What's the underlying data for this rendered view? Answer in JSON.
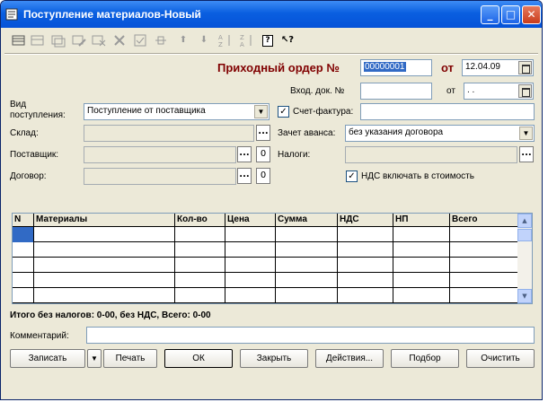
{
  "window": {
    "title": "Поступление материалов-Новый",
    "minimize_glyph": "_",
    "maximize_glyph": "□",
    "close_glyph": "✕"
  },
  "toolbar": {
    "icons": [
      "new-row-icon",
      "add-row-icon",
      "copy-row-icon",
      "edit-row-icon",
      "delete-row-icon",
      "mark-delete-icon",
      "fill-icon",
      "end-edit-icon",
      "move-up-icon",
      "move-down-icon",
      "sort-asc-icon",
      "sort-desc-icon",
      "help-icon",
      "context-help-icon"
    ],
    "up_glyph": "⬆",
    "down_glyph": "⬇",
    "help_glyph": "?",
    "context_help_glyph": "↖?"
  },
  "header": {
    "order_label": "Приходный ордер №",
    "order_number": "00000001",
    "date_label": "от",
    "date_value": "12.04.09",
    "in_doc_label": "Вход. док. №",
    "in_doc_value": "",
    "in_doc_date_label": "от",
    "in_doc_date_value": " .  ."
  },
  "form": {
    "receipt_type_label_1": "Вид",
    "receipt_type_label_2": "поступления:",
    "receipt_type_value": "Поступление от поставщика",
    "invoice_label": "Счет-фактура:",
    "invoice_checked": true,
    "invoice_value": "",
    "warehouse_label": "Склад:",
    "warehouse_value": "",
    "advance_label": "Зачет аванса:",
    "advance_value": "без указания договора",
    "supplier_label": "Поставщик:",
    "supplier_value": "",
    "taxes_label": "Налоги:",
    "taxes_value": "",
    "contract_label": "Договор:",
    "contract_value": "",
    "vat_include_label": "НДС включать в стоимость",
    "vat_include_checked": true,
    "select_glyph": "...",
    "clear_glyph": "0",
    "check_glyph": "✓",
    "dropdown_glyph": "▼"
  },
  "table": {
    "columns": [
      "N",
      "Материалы",
      "Кол-во",
      "Цена",
      "Сумма",
      "НДС",
      "НП",
      "Всего"
    ],
    "rows": [
      [
        "",
        "",
        "",
        "",
        "",
        "",
        "",
        ""
      ],
      [
        "",
        "",
        "",
        "",
        "",
        "",
        "",
        ""
      ],
      [
        "",
        "",
        "",
        "",
        "",
        "",
        "",
        ""
      ],
      [
        "",
        "",
        "",
        "",
        "",
        "",
        "",
        ""
      ],
      [
        "",
        "",
        "",
        "",
        "",
        "",
        "",
        ""
      ]
    ],
    "scroll_up_glyph": "▲",
    "scroll_down_glyph": "▼"
  },
  "totals": {
    "text": "Итого без налогов: 0-00, без НДС, Всего: 0-00"
  },
  "comment": {
    "label": "Комментарий:",
    "value": ""
  },
  "buttons": {
    "save": "Записать",
    "save_menu_glyph": "▼",
    "print": "Печать",
    "ok": "ОК",
    "close": "Закрыть",
    "actions": "Действия...",
    "pick": "Подбор",
    "clear": "Очистить"
  }
}
